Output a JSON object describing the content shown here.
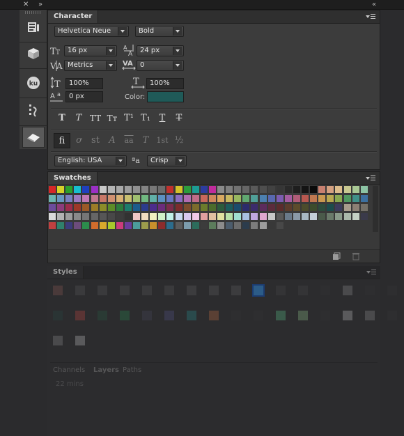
{
  "topbar": {
    "close_glyph": "✕",
    "expand_glyph": "»",
    "collapse_glyph": "«"
  },
  "toolstrip": {
    "items": [
      {
        "name": "character-panel-icon",
        "glyph": "▤"
      },
      {
        "name": "3d-cube-icon",
        "glyph": "⬢"
      },
      {
        "name": "kuler-icon",
        "glyph": "ku"
      },
      {
        "name": "timeline-icon",
        "glyph": "⋮"
      },
      {
        "name": "eraser-panel-icon",
        "glyph": "◆"
      }
    ]
  },
  "character": {
    "tab_label": "Character",
    "font_family": "Helvetica Neue",
    "font_style": "Bold",
    "font_size": "16 px",
    "leading": "24 px",
    "kerning": "Metrics",
    "tracking": "0",
    "vertical_scale": "100%",
    "horizontal_scale": "100%",
    "baseline_shift": "0 px",
    "color_label": "Color:",
    "color_value": "#1f5a58",
    "type_buttons": [
      "T",
      "T",
      "TT",
      "Tт",
      "T¹",
      "T₁",
      "T",
      "T"
    ],
    "opentype_buttons": [
      "fi",
      "ơ",
      "st",
      "A",
      "aa",
      "T",
      "1st",
      "½"
    ],
    "language": "English: USA",
    "aa_icon": "ªa",
    "antialias": "Crisp"
  },
  "swatches": {
    "tab_label": "Swatches",
    "rows": [
      [
        "#d62728",
        "#d5d12a",
        "#2ca02c",
        "#17becf",
        "#1f3fbf",
        "#9b30c6",
        "#c8c8c8",
        "#b4b4b4",
        "#a8a8a8",
        "#9c9c9c",
        "#909090",
        "#848484",
        "#787878",
        "#6c6c6c",
        "#c0302c",
        "#d4c12a",
        "#2c9c3c",
        "#1c9c94",
        "#2c3ca0",
        "#c02c9c",
        "#8a8a8a",
        "#7e7e7e",
        "#727272",
        "#666666",
        "#5a5a5a",
        "#4e4e4e",
        "#424242",
        "#363636",
        "#2a2a2a",
        "#1e1e1e",
        "#141414",
        "#0a0a0a",
        "#c88070",
        "#d4a080",
        "#dcbc8c",
        "#c8c890",
        "#a8c894",
        "#8cc4a4"
      ],
      [
        "#6cb4b0",
        "#6898c0",
        "#7880c0",
        "#9c78c0",
        "#c078b4",
        "#c07890",
        "#c87868",
        "#d09070",
        "#d8b074",
        "#c8c070",
        "#a0c070",
        "#70b880",
        "#60b0a8",
        "#5c90c0",
        "#6878c0",
        "#8c6cc0",
        "#b46cb0",
        "#c06c88",
        "#c8685c",
        "#d0885c",
        "#d8a860",
        "#c8b860",
        "#98b860",
        "#60a870",
        "#50a098",
        "#4c80b0",
        "#5868b0",
        "#7c5cb0",
        "#a45ca0",
        "#b05c78",
        "#b85850",
        "#c07850",
        "#c89850",
        "#b8a850",
        "#88a850",
        "#509860",
        "#409088",
        "#3c70a0"
      ],
      [
        "#6c4c9c",
        "#8c3c7c",
        "#9c2c4c",
        "#9c3828",
        "#9c5a28",
        "#9c7c28",
        "#8c8c28",
        "#5c8c28",
        "#2c7c3c",
        "#1c7c6c",
        "#1c5c8c",
        "#2c3c8c",
        "#4c2c8c",
        "#6c2c7c",
        "#7c2c4c",
        "#7c2c2c",
        "#7c4c2c",
        "#7c6c2c",
        "#6c7c2c",
        "#4c6c2c",
        "#2c5c3c",
        "#1c5c5c",
        "#1c4c6c",
        "#2c2c6c",
        "#3c2c6c",
        "#5c2c5c",
        "#5c2c3c",
        "#5c2c2c",
        "#5c3c2c",
        "#5c4c2c",
        "#4c4c2c",
        "#3c4c2c",
        "#2c4c3c",
        "#1c4c4c",
        "#3c3c5c",
        "#a89c8c",
        "#8c8074",
        "#747068"
      ],
      [
        "#d9d9d9",
        "#b2b2b2",
        "#9c9c9c",
        "#8a8a8a",
        "#767676",
        "#666666",
        "#565656",
        "#484848",
        "#3c3c3c",
        "#323232",
        "#f0c8c8",
        "#f0dcc0",
        "#f0f0c0",
        "#d0f0c8",
        "#c0f0e8",
        "#c8d8f0",
        "#d8c8f0",
        "#f0c8e8",
        "#e0a0a0",
        "#e0c0a0",
        "#e0e0a0",
        "#b8e0a8",
        "#a0e0d0",
        "#a8c0e0",
        "#c0a8e0",
        "#e0a8d0",
        "#c8c8c8",
        "#5a5a5a",
        "#6a7a8a",
        "#8a9aa8",
        "#a8b8c4",
        "#c4d0d8",
        "#4a5a4a",
        "#6a7a6a",
        "#8a9a8a",
        "#aab8aa",
        "#c4d0c4",
        "#3a3a4a"
      ],
      [
        "#c04040",
        "#30806c",
        "#3c3c7c",
        "#6c4c7c",
        "#2c8c4c",
        "#d06c2c",
        "#d8a82c",
        "#a8c82c",
        "#cc3c7c",
        "#6c3c9c",
        "#4c9c9c",
        "#9c9c4c",
        "#c8902c",
        "#8c2c2c",
        "#2c6c8c",
        "#5c5c5c",
        "#7c9cac",
        "#2c6c5c",
        "#3c3c3c",
        "#5c7c5c",
        "#8c8c8c",
        "#4c5c6c",
        "#6c6c6c",
        "#2c3c4c",
        "#7c7c7c",
        "#9c9c9c",
        "#383838",
        "#484848"
      ]
    ]
  },
  "styles": {
    "tab_label": "Styles",
    "bottom_tabs": [
      "Channels",
      "Layers",
      "Paths"
    ],
    "bottom_value": "22 mins"
  }
}
